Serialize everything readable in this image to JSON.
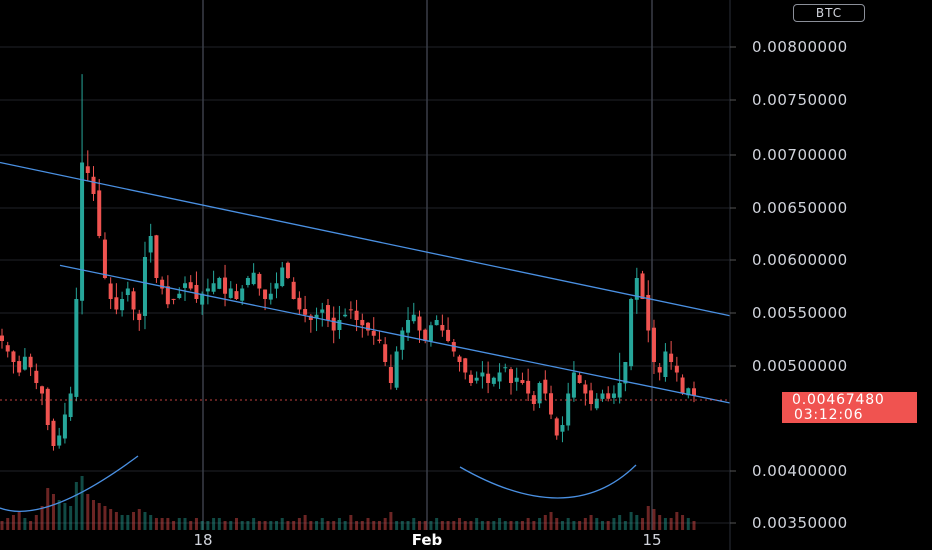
{
  "badge": {
    "currency": "BTC"
  },
  "last_price": {
    "value": "0.00467480",
    "countdown": "03:12:06",
    "color": "#f05350"
  },
  "colors": {
    "up": "#26a69a",
    "down": "#ef5350",
    "trendline": "#4a90e2",
    "grid": "#1f2229",
    "background": "#000000"
  },
  "chart_data": {
    "type": "candlestick",
    "y_ticks": [
      "0.00800000",
      "0.00750000",
      "0.00700000",
      "0.00650000",
      "0.00600000",
      "0.00550000",
      "0.00500000",
      "0.00400000",
      "0.00350000"
    ],
    "x_ticks": [
      {
        "label": "18",
        "bold": false
      },
      {
        "label": "Feb",
        "bold": true
      },
      {
        "label": "15",
        "bold": false
      }
    ],
    "ylim": [
      0.0035,
      0.0082
    ],
    "grid": true,
    "trendlines": [
      {
        "name": "",
        "points": [
          [
            0,
            0.0069
          ],
          [
            730,
            0.00544
          ]
        ]
      },
      {
        "name": "",
        "points": [
          [
            60,
            0.00592
          ],
          [
            730,
            0.00461
          ]
        ]
      }
    ],
    "closes": [
      0.0052,
      0.0051,
      0.005,
      0.0049,
      0.00505,
      0.00495,
      0.0048,
      0.0047,
      0.0044,
      0.0042,
      0.0043,
      0.0045,
      0.0047,
      0.0056,
      0.0069,
      0.0068,
      0.0066,
      0.0062,
      0.0058,
      0.0056,
      0.0055,
      0.0056,
      0.0057,
      0.0055,
      0.0054,
      0.006,
      0.0062,
      0.0058,
      0.0057,
      0.00555,
      0.0056,
      0.00565,
      0.00575,
      0.0057,
      0.0056,
      0.00565,
      0.0057,
      0.00575,
      0.0058,
      0.00565,
      0.0057,
      0.0056,
      0.0057,
      0.0058,
      0.00585,
      0.0057,
      0.0056,
      0.00565,
      0.00575,
      0.0059,
      0.0058,
      0.0056,
      0.0055,
      0.00545,
      0.0054,
      0.00545,
      0.0055,
      0.0054,
      0.0053,
      0.0054,
      0.00545,
      0.0055,
      0.0054,
      0.00535,
      0.0053,
      0.00525,
      0.0052,
      0.005,
      0.0048,
      0.0051,
      0.0053,
      0.0054,
      0.00545,
      0.0053,
      0.0052,
      0.00535,
      0.0054,
      0.0053,
      0.0052,
      0.0051,
      0.005,
      0.0049,
      0.0048,
      0.00485,
      0.0049,
      0.0048,
      0.00485,
      0.0049,
      0.00495,
      0.0048,
      0.00485,
      0.0048,
      0.0047,
      0.0046,
      0.0048,
      0.0047,
      0.0045,
      0.0043,
      0.0044,
      0.0047,
      0.0049,
      0.0048,
      0.0047,
      0.0046,
      0.00465,
      0.0047,
      0.00465,
      0.0047,
      0.0048,
      0.005,
      0.0056,
      0.0058,
      0.0056,
      0.0053,
      0.005,
      0.0049,
      0.0051,
      0.005,
      0.0049,
      0.0047,
      0.00475,
      0.00468
    ],
    "volumes": [
      3,
      4,
      5,
      6,
      4,
      3,
      5,
      8,
      14,
      12,
      10,
      9,
      8,
      16,
      18,
      12,
      10,
      9,
      8,
      7,
      6,
      5,
      5,
      6,
      7,
      6,
      5,
      4,
      4,
      4,
      3,
      4,
      4,
      3,
      4,
      3,
      3,
      4,
      4,
      3,
      3,
      4,
      3,
      3,
      4,
      3,
      3,
      3,
      3,
      4,
      3,
      3,
      4,
      5,
      3,
      3,
      4,
      3,
      3,
      4,
      3,
      5,
      3,
      3,
      4,
      3,
      3,
      4,
      6,
      3,
      3,
      3,
      4,
      3,
      3,
      3,
      4,
      3,
      3,
      3,
      4,
      3,
      3,
      4,
      3,
      3,
      3,
      4,
      3,
      3,
      3,
      3,
      4,
      3,
      4,
      5,
      6,
      4,
      3,
      4,
      3,
      3,
      4,
      5,
      4,
      3,
      3,
      4,
      5,
      3,
      6,
      5,
      4,
      8,
      7,
      5,
      4,
      4,
      6,
      5,
      4,
      3
    ]
  }
}
